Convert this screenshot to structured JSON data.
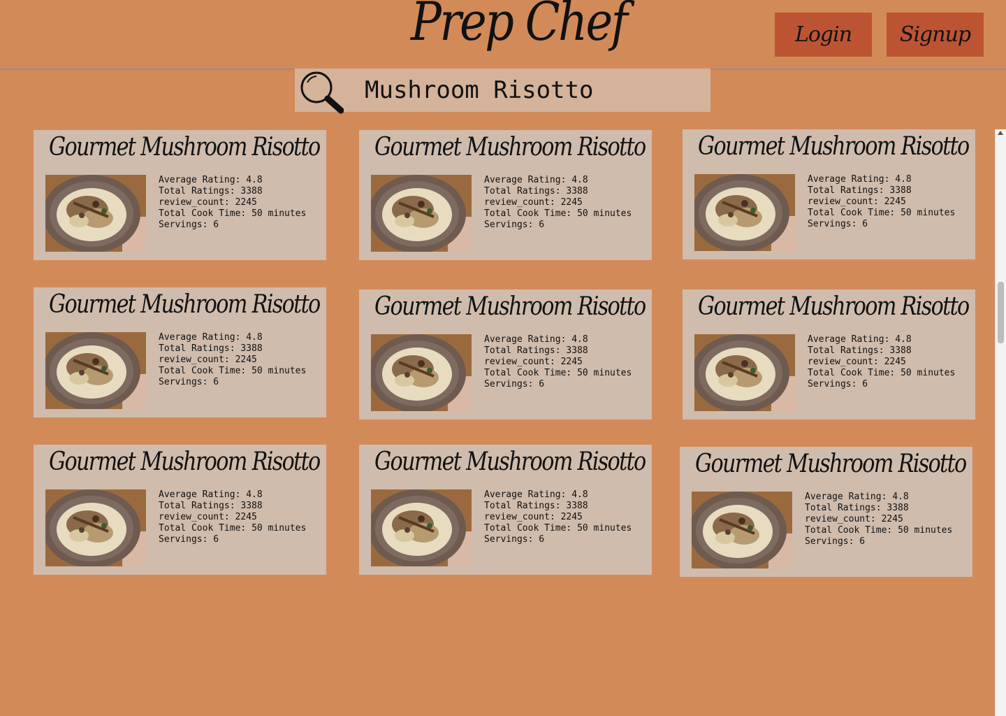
{
  "header": {
    "brand": "Prep Chef",
    "login_label": "Login",
    "signup_label": "Signup"
  },
  "search": {
    "value": "Mushroom Risotto"
  },
  "labels": {
    "average_rating": "Average Rating:",
    "total_ratings": "Total Ratings:",
    "review_count": "review_count:",
    "total_cook_time": "Total Cook Time:",
    "servings": "Servings:"
  },
  "recipes": [
    {
      "title": "Gourmet Mushroom Risotto",
      "average_rating": "4.8",
      "total_ratings": "3388",
      "review_count": "2245",
      "cook_time": "50 minutes",
      "servings": "6"
    },
    {
      "title": "Gourmet Mushroom Risotto",
      "average_rating": "4.8",
      "total_ratings": "3388",
      "review_count": "2245",
      "cook_time": "50 minutes",
      "servings": "6"
    },
    {
      "title": "Gourmet Mushroom Risotto",
      "average_rating": "4.8",
      "total_ratings": "3388",
      "review_count": "2245",
      "cook_time": "50 minutes",
      "servings": "6"
    },
    {
      "title": "Gourmet Mushroom Risotto",
      "average_rating": "4.8",
      "total_ratings": "3388",
      "review_count": "2245",
      "cook_time": "50 minutes",
      "servings": "6"
    },
    {
      "title": "Gourmet Mushroom Risotto",
      "average_rating": "4.8",
      "total_ratings": "3388",
      "review_count": "2245",
      "cook_time": "50 minutes",
      "servings": "6"
    },
    {
      "title": "Gourmet Mushroom Risotto",
      "average_rating": "4.8",
      "total_ratings": "3388",
      "review_count": "2245",
      "cook_time": "50 minutes",
      "servings": "6"
    },
    {
      "title": "Gourmet Mushroom Risotto",
      "average_rating": "4.8",
      "total_ratings": "3388",
      "review_count": "2245",
      "cook_time": "50 minutes",
      "servings": "6"
    },
    {
      "title": "Gourmet Mushroom Risotto",
      "average_rating": "4.8",
      "total_ratings": "3388",
      "review_count": "2245",
      "cook_time": "50 minutes",
      "servings": "6"
    },
    {
      "title": "Gourmet Mushroom Risotto",
      "average_rating": "4.8",
      "total_ratings": "3388",
      "review_count": "2245",
      "cook_time": "50 minutes",
      "servings": "6"
    }
  ],
  "colors": {
    "page_background": "#d38a59",
    "button_background": "#bc5434",
    "card_background": "#cfbcad",
    "search_background": "#d5b29a"
  }
}
